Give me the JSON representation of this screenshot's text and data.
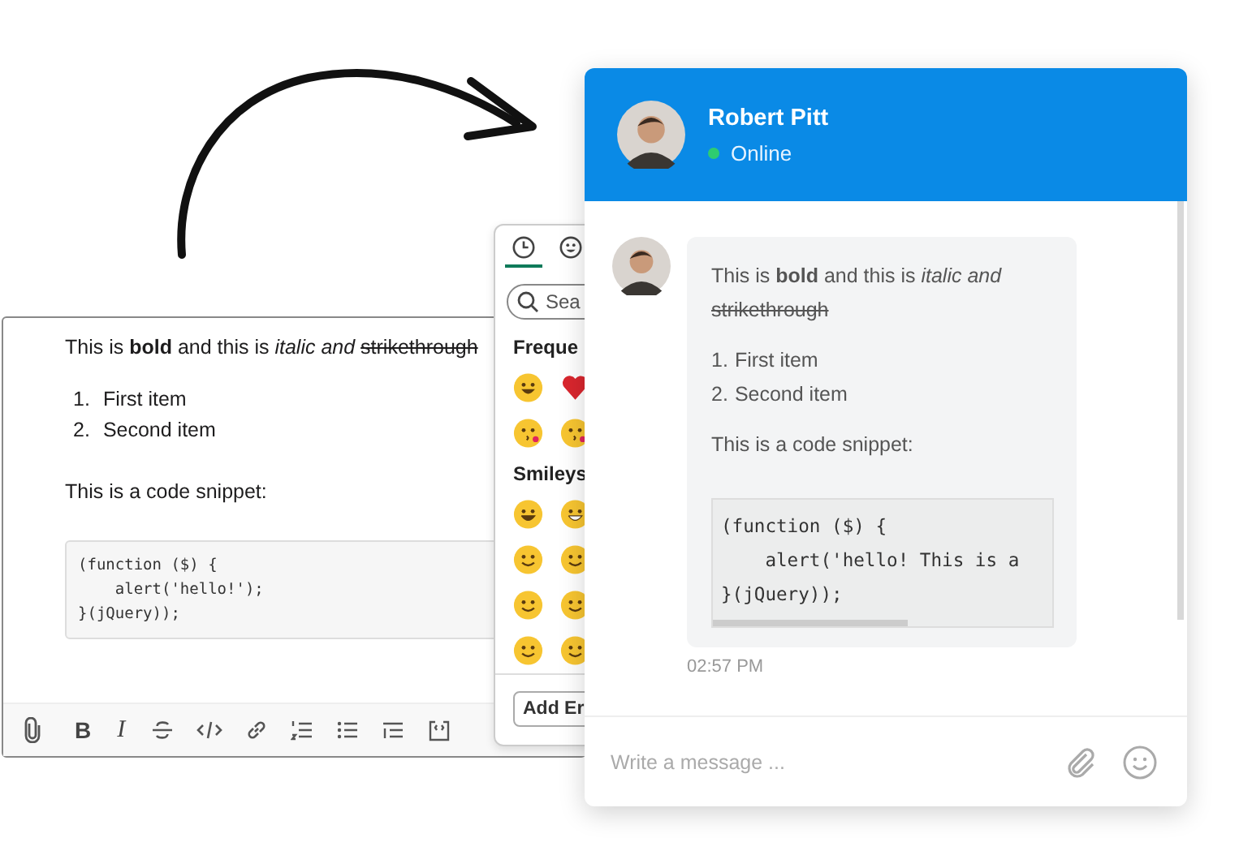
{
  "editor": {
    "paragraph": {
      "text": "This is **bold** and this is *italic and*",
      "struck": "strikethrough"
    },
    "list": [
      {
        "number": "1.",
        "text": "First item"
      },
      {
        "number": "2.",
        "text": "Second item"
      }
    ],
    "snippet_label": "This is a code snippet:",
    "code": [
      "(function ($) {",
      "    alert('hello!');",
      "}(jQuery));"
    ],
    "toolbar_glyphs": [
      "B",
      "I"
    ]
  },
  "emoji_picker": {
    "tabs": [
      {
        "selected": true
      },
      {
        "selected": false
      }
    ],
    "search": {
      "placeholder": "Sea"
    },
    "sections": [
      "Freque",
      "Smileys"
    ],
    "button": "Add Er"
  },
  "chat": {
    "header": {
      "name": "Robert Pitt",
      "online": true,
      "status": "Online"
    },
    "message": {
      "paragraph": {
        "text": "This is **bold** and this is *italic and*",
        "struck": "strikethrough"
      },
      "list": [
        {
          "number": "1.",
          "text": "First item"
        },
        {
          "number": "2.",
          "text": "Second item"
        }
      ],
      "snippet_label": "This is a code snippet:",
      "code": [
        "(function ($) {",
        "    alert('hello! This is a",
        "}(jQuery));"
      ],
      "time": "02:57 PM"
    },
    "composer": {
      "placeholder": "Write a message ..."
    }
  }
}
